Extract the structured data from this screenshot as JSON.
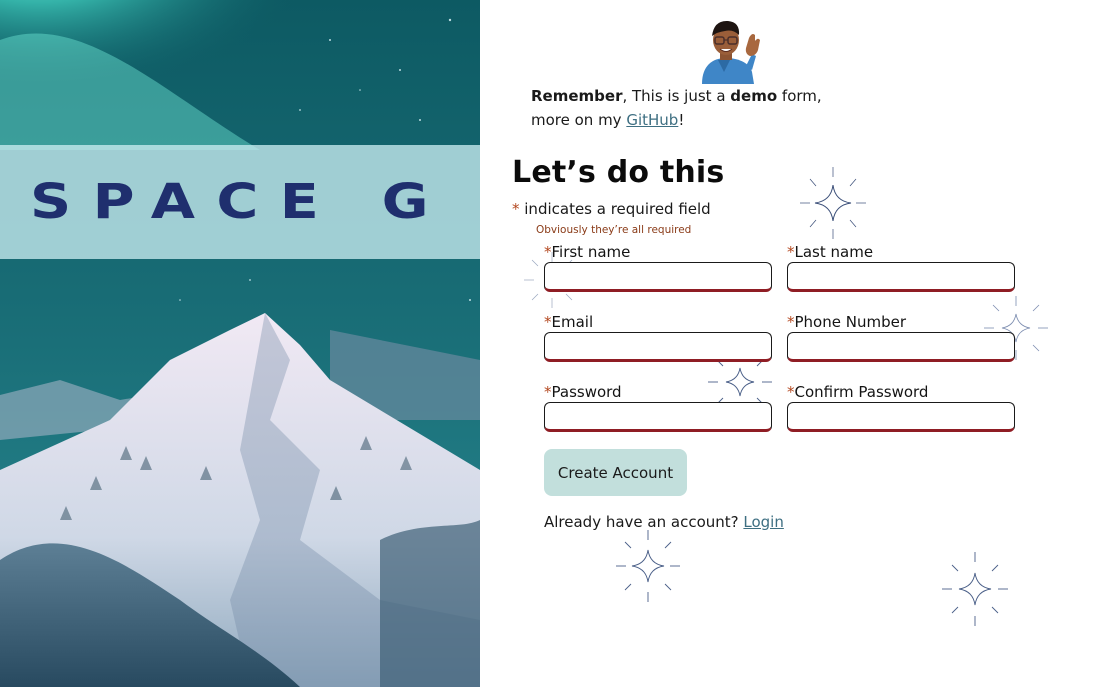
{
  "brand": {
    "logo_text": "SPACE G"
  },
  "note": {
    "bold_word": "Remember",
    "part1": ", This is just a ",
    "bold_demo": "demo",
    "part2": " form, more on my ",
    "link": "GitHub",
    "end": "!"
  },
  "form": {
    "heading": "Let’s do this",
    "required_star": "*",
    "required_text": " indicates a required field",
    "required_sub": "Obviously they’re all required",
    "fields": {
      "first_name": {
        "label": "First name",
        "value": ""
      },
      "last_name": {
        "label": "Last name",
        "value": ""
      },
      "email": {
        "label": "Email",
        "value": ""
      },
      "phone": {
        "label": "Phone Number",
        "value": ""
      },
      "password": {
        "label": "Password",
        "value": ""
      },
      "confirm_password": {
        "label": "Confirm Password",
        "value": ""
      }
    },
    "submit_label": "Create Account",
    "login_prompt": "Already have an account? ",
    "login_link": "Login"
  },
  "colors": {
    "accent_link": "#3e6f82",
    "required_star": "#b3471f",
    "input_border_bottom": "#8f1d24",
    "button_bg": "#c2dfdc",
    "logo_navy": "#1f2f6e"
  },
  "icons": [
    "sparkle-icon",
    "memoji-avatar"
  ]
}
